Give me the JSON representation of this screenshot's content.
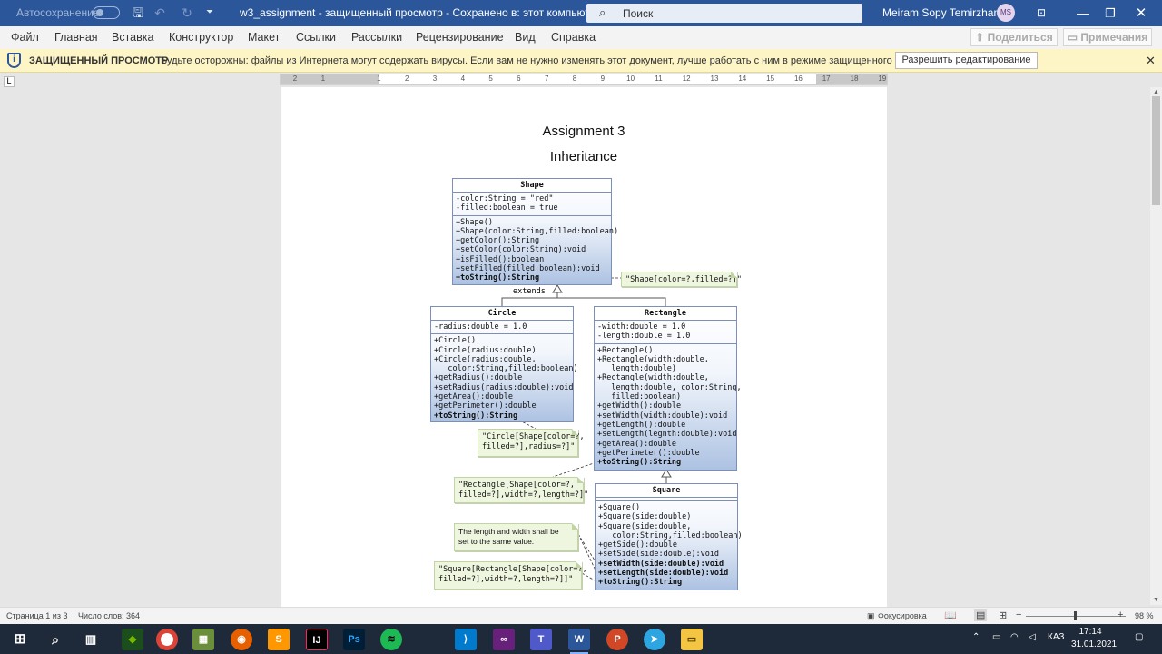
{
  "titlebar": {
    "autosave": "Автосохранение",
    "doc_title": "w3_assignment  -  защищенный просмотр  -  Сохранено в: этот компьютер  ▾",
    "search_placeholder": "Поиск",
    "user_name": "Meiram Sopy Temirzhanov",
    "user_initials": "MS"
  },
  "menu": {
    "items": [
      "Файл",
      "Главная",
      "Вставка",
      "Конструктор",
      "Макет",
      "Ссылки",
      "Рассылки",
      "Рецензирование",
      "Вид",
      "Справка"
    ],
    "share": "Поделиться",
    "notes": "Примечания"
  },
  "protected_view": {
    "title": "ЗАЩИЩЕННЫЙ ПРОСМОТР",
    "message": "Будьте осторожны: файлы из Интернета могут содержать вирусы. Если вам не нужно изменять этот документ, лучше работать с ним в режиме защищенного просмотра.",
    "enable_button": "Разрешить редактирование"
  },
  "ruler": {
    "numbers": [
      "2",
      "1",
      "",
      "1",
      "2",
      "3",
      "4",
      "5",
      "6",
      "7",
      "8",
      "9",
      "10",
      "11",
      "12",
      "13",
      "14",
      "15",
      "16",
      "17",
      "18",
      "19"
    ]
  },
  "document": {
    "title": "Assignment 3",
    "subtitle": "Inheritance",
    "extends_label": "extends",
    "shape": {
      "name": "Shape",
      "fields": [
        "-color:String = \"red\"",
        "-filled:boolean = true"
      ],
      "methods": [
        "+Shape()",
        "+Shape(color:String,filled:boolean)",
        "+getColor():String",
        "+setColor(color:String):void",
        "+isFilled():boolean",
        "+setFilled(filled:boolean):void",
        "+toString():String"
      ]
    },
    "circle": {
      "name": "Circle",
      "fields": [
        "-radius:double = 1.0"
      ],
      "methods": [
        "+Circle()",
        "+Circle(radius:double)",
        "+Circle(radius:double,",
        "   color:String,filled:boolean)",
        "+getRadius():double",
        "+setRadius(radius:double):void",
        "+getArea():double",
        "+getPerimeter():double",
        "+toString():String"
      ]
    },
    "rectangle": {
      "name": "Rectangle",
      "fields": [
        "-width:double = 1.0",
        "-length:double = 1.0"
      ],
      "methods": [
        "+Rectangle()",
        "+Rectangle(width:double,",
        "   length:double)",
        "+Rectangle(width:double,",
        "   length:double, color:String,",
        "   filled:boolean)",
        "+getWidth():double",
        "+setWidth(width:double):void",
        "+getLength():double",
        "+setLength(legnth:double):void",
        "+getArea():double",
        "+getPerimeter():double",
        "+toString():String"
      ]
    },
    "square": {
      "name": "Square",
      "methods": [
        "+Square()",
        "+Square(side:double)",
        "+Square(side:double,",
        "   color:String,filled:boolean)",
        "+getSide():double",
        "+setSide(side:double):void",
        "+setWidth(side:double):void",
        "+setLength(side:double):void",
        "+toString():String"
      ]
    },
    "notes": {
      "shape": [
        "\"Shape[color=?,filled=?]\""
      ],
      "circle": [
        "\"Circle[Shape[color=?,",
        "filled=?],radius=?]\""
      ],
      "rectangle": [
        "\"Rectangle[Shape[color=?,",
        "filled=?],width=?,length=?]\""
      ],
      "square_rule": [
        "The length and width shall be",
        "set to the same value."
      ],
      "square": [
        "\"Square[Rectangle[Shape[color=?,",
        "filled=?],width=?,length=?]]\""
      ]
    }
  },
  "statusbar": {
    "page": "Страница 1 из 3",
    "words": "Число слов: 364",
    "focus": "Фокусировка",
    "zoom": "98 %",
    "zoom_fraction": 0.49
  },
  "taskbar": {
    "lang": "КАЗ",
    "time": "17:14",
    "date": "31.01.2021",
    "apps": [
      "nvidia",
      "chrome",
      "minecraft",
      "firefox",
      "sublime",
      "intellij",
      "photoshop",
      "spotify",
      "visual-studio-code",
      "visual-studio",
      "teams",
      "word",
      "powerpoint",
      "telegram",
      "file-explorer"
    ]
  }
}
